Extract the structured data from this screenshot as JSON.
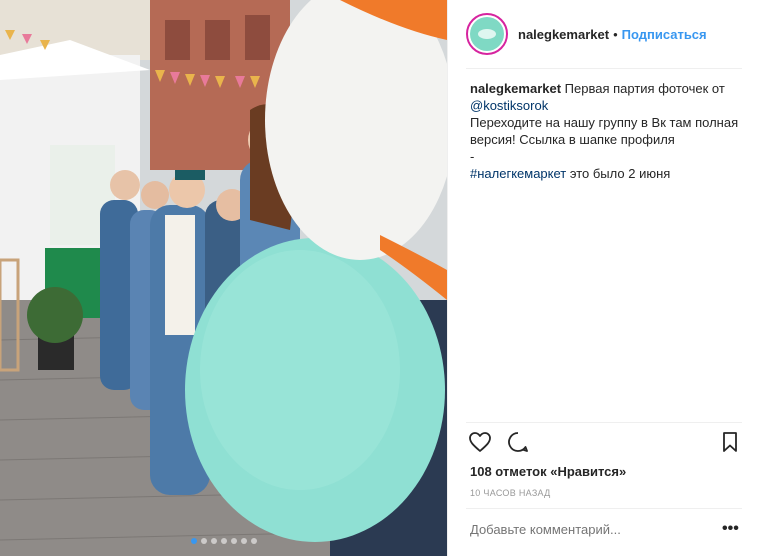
{
  "post": {
    "username": "nalegkemarket",
    "separator": "•",
    "follow_label": "Подписаться",
    "caption": {
      "author": "nalegkemarket",
      "line1_rest": " Первая партия фоточек от",
      "mention": "@kostiksorok",
      "line3": "Переходите на нашу группу в Вк там полная",
      "line4": "версия! Ссылка в шапке профиля",
      "line5": "-",
      "hashtag": "#налегкемаркет",
      "line6_rest": " это было 2 июня"
    },
    "likes_text": "108 отметок «Нравится»",
    "time_text": "10 часов назад",
    "comment_placeholder": "Добавьте комментарий...",
    "more_label": "•••"
  },
  "carousel": {
    "count": 7,
    "active_index": 0
  },
  "colors": {
    "link_blue": "#3897f0",
    "balloon_mint": "#8fe0d3",
    "balloon_orange": "#f07a2a"
  },
  "icons": [
    "heart-icon",
    "comment-icon",
    "bookmark-icon"
  ]
}
